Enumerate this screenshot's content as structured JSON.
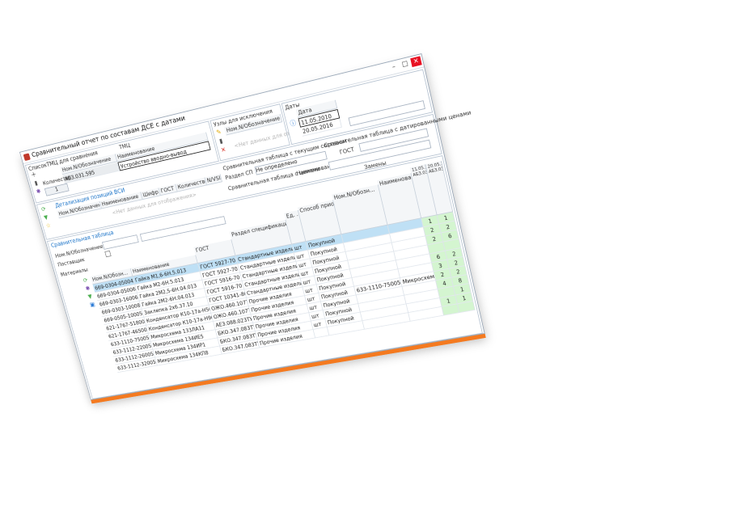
{
  "window": {
    "title": "Сравнительный отчет по составам ДСЕ с датами",
    "minimize": "–",
    "maximize": "□",
    "close": "✕",
    "restore": "⧉"
  },
  "top_left": {
    "tab": "СписокТМЦ для сравнения",
    "tmc_header": "ТМЦ",
    "col_designation": "Ном.N/Обозначение",
    "col_name": "Наименование",
    "row_designation": "АБЗ.031.595",
    "row_name": "Устройство вводно-вывод",
    "qty_label": "Количество",
    "qty_value": "1"
  },
  "exclusions": {
    "title": "Узлы для исключения",
    "col": "Ном.N/Обозначение",
    "empty_hint": "<Нет данных для отображения>"
  },
  "dates": {
    "title": "Даты",
    "col": "Дата",
    "rows": [
      "11.05.2010",
      "20.05.2016"
    ]
  },
  "vsi": {
    "title": "Детализация позиций ВСИ",
    "col_designation": "Ном.N/Обозначение",
    "col_name": "Наименование",
    "col_code": "Шифр",
    "col_gost": "ГОСТ",
    "col_qty": "Количество",
    "col_no": "N/VSI",
    "hint": "<Нет данных для отображения>",
    "tab_current": "Сравнительная таблица с текущим составом",
    "tab_dates": "Сравнительная таблица с датированными ценами",
    "section_label": "Раздел СП",
    "section_value": "Не определено",
    "gost_label": "ГОСТ",
    "prices_label": "Сравнительная таблица с ценами",
    "name_label": "Наименование",
    "replace_label": "Замены"
  },
  "compare": {
    "tab": "Сравнительная таблица",
    "designation_label": "Ном.N/Обозначение",
    "supplier_label": "Поставщик",
    "materials_label": "Материалы",
    "col_designation": "Ном.N/Обозн...",
    "col_name": "Наименование",
    "col_gost": "ГОСТ",
    "col_section": "Раздел спецификации",
    "col_unit": "Ед. ...",
    "col_method": "Способ приобрет...",
    "col_repl_designation": "Ном.N/Обозн...",
    "col_repl_name": "Наименование",
    "col_date1": "11.05.2010 АБЗ.031.595",
    "col_date2": "20.05.2016 АБЗ.031.595",
    "rows": [
      {
        "designation": "669-0304-0500490",
        "name": "Гайка М1,6-6Н.5.013",
        "gost": "ГОСТ 5927-70",
        "section": "Стандартные изделия",
        "unit": "шт",
        "method": "Покупной",
        "repl_designation": "",
        "repl_name": "",
        "q1": "1",
        "q2": "1"
      },
      {
        "designation": "669-0304-0500690",
        "name": "Гайка М2-6Н.5.013",
        "gost": "ГОСТ 5927-70",
        "section": "Стандартные изделия",
        "unit": "шт",
        "method": "Покупной",
        "repl_designation": "",
        "repl_name": "",
        "q1": "2",
        "q2": "2"
      },
      {
        "designation": "669-0303-1600690",
        "name": "Гайка 2М2,5-6Н.04.013",
        "gost": "ГОСТ 5916-70",
        "section": "Стандартные изделия",
        "unit": "шт",
        "method": "Покупной",
        "repl_designation": "",
        "repl_name": "",
        "q1": "2",
        "q2": "6"
      },
      {
        "designation": "669-0303-1000890",
        "name": "Гайка 2М2-6Н.04.013",
        "gost": "ГОСТ 5916-70",
        "section": "Стандартные изделия",
        "unit": "шт",
        "method": "Покупной",
        "repl_designation": "",
        "repl_name": "",
        "q1": "",
        "q2": ""
      },
      {
        "designation": "669-0505-1000590",
        "name": "Заклепка 2х6.37.10",
        "gost": "ГОСТ 10341-80",
        "section": "Стандартные изделия",
        "unit": "шт",
        "method": "Покупной",
        "repl_designation": "",
        "repl_name": "",
        "q1": "6",
        "q2": "2"
      },
      {
        "designation": "621-1767-5180090",
        "name": "Конденсатор К10-17а-Н50-0,1...",
        "gost": "ОЖО.460.107ТУ",
        "section": "Прочие изделия",
        "unit": "шт",
        "method": "Покупной",
        "repl_designation": "",
        "repl_name": "",
        "q1": "3",
        "q2": "2"
      },
      {
        "designation": "621-1767-4650090",
        "name": "Конденсатор К10-17а-Н90-0,4...",
        "gost": "ОЖО.460.107ТУ",
        "section": "Прочие изделия",
        "unit": "шт",
        "method": "Покупной",
        "repl_designation": "633-1110-7500500",
        "repl_name": "Микросхема 133ЛА11 (ЗАЛ...",
        "q1": "2",
        "q2": "2"
      },
      {
        "designation": "633-1110-7500500",
        "name": "Микросхема 133ЛА11",
        "gost": "АЕЗ.088.023ТУ",
        "section": "Прочие изделия",
        "unit": "шт",
        "method": "Покупной",
        "repl_designation": "",
        "repl_name": "",
        "q1": "4",
        "q2": "8"
      },
      {
        "designation": "633-1112-2200500",
        "name": "Микросхема 134ИЕ5",
        "gost": "БКО.347.083ТУ3",
        "section": "Прочие изделия",
        "unit": "шт",
        "method": "Покупной",
        "repl_designation": "",
        "repl_name": "",
        "q1": "",
        "q2": "1"
      },
      {
        "designation": "633-1112-2600500",
        "name": "Микросхема 134ИР1",
        "gost": "БКО.347.083ТУ3",
        "section": "Прочие изделия",
        "unit": "шт",
        "method": "Покупной",
        "repl_designation": "",
        "repl_name": "",
        "q1": "1",
        "q2": "1"
      },
      {
        "designation": "633-1112-3200500",
        "name": "Микросхема 134КП8",
        "gost": "БКО.347.083ТУ3",
        "section": "Прочие изделия",
        "unit": "",
        "method": "",
        "repl_designation": "",
        "repl_name": "",
        "q1": "",
        "q2": ""
      }
    ]
  },
  "colors": {
    "accent": "#1a73c8",
    "selection": "#bfe0f5",
    "green": "#d4f5d0",
    "shadow": "#f47a20",
    "close": "#e81123"
  }
}
